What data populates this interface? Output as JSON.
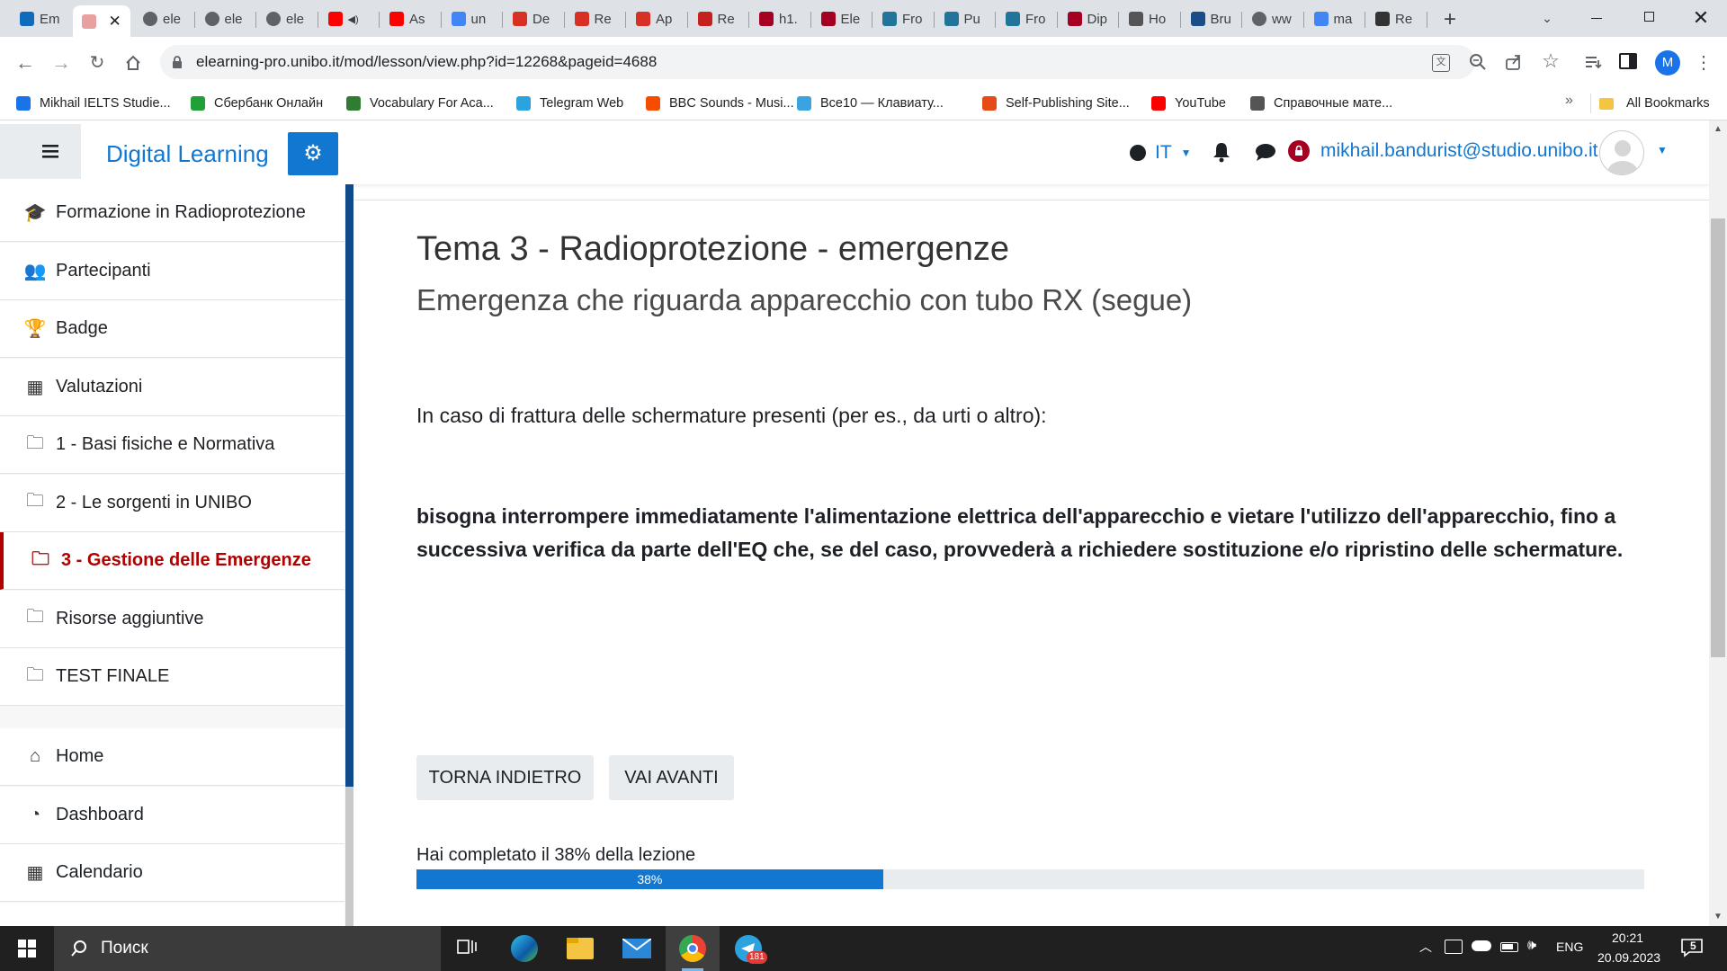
{
  "browser": {
    "tabs": [
      {
        "title": "Em",
        "icon": "outlook-icon",
        "color": "#0f6cbd"
      },
      {
        "title": "",
        "icon": "pinned-site-icon",
        "color": "#e8a0a0",
        "active": true
      },
      {
        "title": "ele",
        "icon": "globe-icon",
        "color": "#5f6368"
      },
      {
        "title": "ele",
        "icon": "globe-icon",
        "color": "#5f6368"
      },
      {
        "title": "ele",
        "icon": "globe-icon",
        "color": "#5f6368"
      },
      {
        "title": "",
        "icon": "youtube-icon",
        "color": "#ff0000"
      },
      {
        "title": "As",
        "icon": "youtube-icon",
        "color": "#ff0000"
      },
      {
        "title": "un",
        "icon": "google-icon",
        "color": "#4285f4"
      },
      {
        "title": "De",
        "icon": "site-icon",
        "color": "#d93025"
      },
      {
        "title": "Re",
        "icon": "site-icon",
        "color": "#d93025"
      },
      {
        "title": "Ap",
        "icon": "site-icon",
        "color": "#d93025"
      },
      {
        "title": "Re",
        "icon": "site-icon",
        "color": "#c5221f"
      },
      {
        "title": "h1.",
        "icon": "unibo-icon",
        "color": "#a50021"
      },
      {
        "title": "Ele",
        "icon": "unibo-icon",
        "color": "#a50021"
      },
      {
        "title": "Fro",
        "icon": "wordpress-icon",
        "color": "#21759b"
      },
      {
        "title": "Pu",
        "icon": "wordpress-icon",
        "color": "#21759b"
      },
      {
        "title": "Fro",
        "icon": "wordpress-icon",
        "color": "#21759b"
      },
      {
        "title": "Dip",
        "icon": "unibo-icon",
        "color": "#a50021"
      },
      {
        "title": "Ho",
        "icon": "site-icon",
        "color": "#555"
      },
      {
        "title": "Bru",
        "icon": "site-icon",
        "color": "#1a4c8a"
      },
      {
        "title": "ww",
        "icon": "globe-icon",
        "color": "#5f6368"
      },
      {
        "title": "ma",
        "icon": "google-icon",
        "color": "#4285f4"
      },
      {
        "title": "Re",
        "icon": "site-icon",
        "color": "#333"
      }
    ],
    "url": "elearning-pro.unibo.it/mod/lesson/view.php?id=12268&pageid=4688",
    "profile_initial": "M",
    "bookmarks": [
      {
        "label": "Mikhail IELTS Studie...",
        "color": "#1a73e8"
      },
      {
        "label": "Сбербанк Онлайн",
        "color": "#21a038"
      },
      {
        "label": "Vocabulary For Aca...",
        "color": "#2e7d32"
      },
      {
        "label": "Telegram Web",
        "color": "#2aa3df"
      },
      {
        "label": "BBC Sounds - Musi...",
        "color": "#f54c00"
      },
      {
        "label": "Все10 — Клавиату...",
        "color": "#3ba4e0"
      },
      {
        "label": "Self-Publishing Site...",
        "color": "#e64a19"
      },
      {
        "label": "YouTube",
        "color": "#ff0000"
      },
      {
        "label": "Справочные мате...",
        "color": "#555"
      }
    ],
    "all_bookmarks": "All Bookmarks"
  },
  "header": {
    "brand": "Digital Learning",
    "language": "IT",
    "user_email": "mikhail.bandurist@studio.unibo.it"
  },
  "sidebar": {
    "items": [
      {
        "label": "Formazione in Radioprotezione",
        "icon": "graduation-cap-icon"
      },
      {
        "label": "Partecipanti",
        "icon": "users-icon"
      },
      {
        "label": "Badge",
        "icon": "trophy-icon"
      },
      {
        "label": "Valutazioni",
        "icon": "table-icon"
      },
      {
        "label": "1 - Basi fisiche e Normativa",
        "icon": "folder-icon"
      },
      {
        "label": "2 - Le sorgenti in UNIBO",
        "icon": "folder-icon"
      },
      {
        "label": "3 - Gestione delle Emergenze",
        "icon": "folder-icon",
        "active": true
      },
      {
        "label": "Risorse aggiuntive",
        "icon": "folder-icon"
      },
      {
        "label": "TEST FINALE",
        "icon": "folder-icon"
      }
    ],
    "items2": [
      {
        "label": "Home",
        "icon": "home-icon"
      },
      {
        "label": "Dashboard",
        "icon": "dashboard-icon"
      },
      {
        "label": "Calendario",
        "icon": "calendar-icon"
      }
    ]
  },
  "main": {
    "title": "Tema 3 - Radioprotezione - emergenze",
    "subtitle": "Emergenza che riguarda apparecchio con tubo RX (segue)",
    "intro": "In caso di frattura delle schermature presenti (per es., da urti o altro):",
    "bold_text": "bisogna interrompere immediatamente l'alimentazione elettrica dell'apparecchio e vietare l'utilizzo dell'apparecchio, fino a successiva verifica da parte dell'EQ che, se del caso, provvederà a richiedere sostituzione e/o ripristino delle schermature.",
    "back_button": "TORNA INDIETRO",
    "next_button": "VAI AVANTI",
    "progress_text": "Hai completato il 38% della lezione",
    "progress_label": "38%",
    "progress_value": 0.38,
    "progress_color": "#1177d1"
  },
  "taskbar": {
    "search_placeholder": "Поиск",
    "language": "ENG",
    "time": "20:21",
    "date": "20.09.2023",
    "telegram_badge": "181",
    "notifications": "5"
  }
}
